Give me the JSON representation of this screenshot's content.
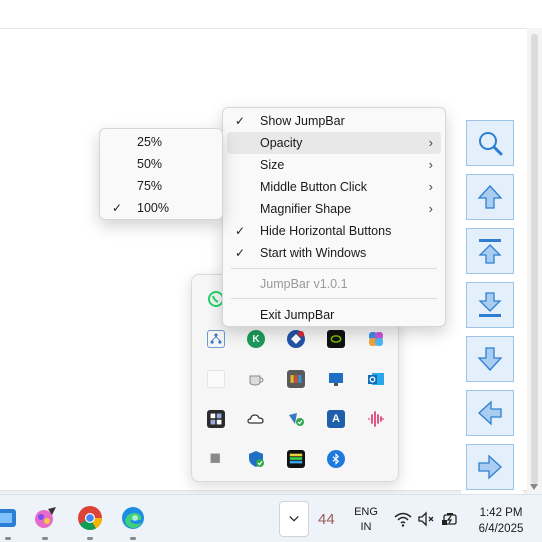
{
  "context_menu": {
    "items": [
      {
        "label": "Show JumpBar",
        "checked": "✓"
      },
      {
        "label": "Opacity",
        "submenu": "›"
      },
      {
        "label": "Size",
        "submenu": "›"
      },
      {
        "label": "Middle Button Click",
        "submenu": "›"
      },
      {
        "label": "Magnifier Shape",
        "submenu": "›"
      },
      {
        "label": "Hide Horizontal Buttons",
        "checked": "✓"
      },
      {
        "label": "Start with Windows",
        "checked": "✓"
      }
    ],
    "version": "JumpBar v1.0.1",
    "exit": "Exit JumpBar"
  },
  "opacity_submenu": {
    "items": [
      {
        "label": "25%"
      },
      {
        "label": "50%"
      },
      {
        "label": "75%"
      },
      {
        "label": "100%",
        "checked": "✓"
      }
    ]
  },
  "jumpbar": {
    "buttons": [
      "magnifier-icon",
      "arrow-up-icon",
      "jump-to-top-icon",
      "jump-to-bottom-icon",
      "arrow-down-icon",
      "arrow-left-icon",
      "arrow-right-icon"
    ],
    "accent": "#2f7fd1",
    "button_bg": "#e3effb"
  },
  "tray_overflow": {
    "icons": [
      "whatsapp-icon",
      "network-share-icon",
      "kaspersky-icon",
      "vpn-shield-icon",
      "nvidia-icon",
      "copilot-icon",
      "blank-app-icon",
      "coffee-cup-icon",
      "folder-app-icon",
      "monitor-app-icon",
      "outlook-icon",
      "widgets-app-icon",
      "onedrive-icon",
      "security-app-icon",
      "font-app-icon",
      "audio-wave-icon",
      "grey-square-icon",
      "defender-shield-icon",
      "keyboard-app-icon",
      "bluetooth-icon"
    ]
  },
  "taskbar": {
    "apps": [
      "files-app-icon",
      "paint-app-icon",
      "chrome-icon",
      "edge-icon"
    ],
    "tray_count": "44",
    "lang_line1": "ENG",
    "lang_line2": "IN",
    "time": "1:42 PM",
    "date": "6/4/2025"
  }
}
